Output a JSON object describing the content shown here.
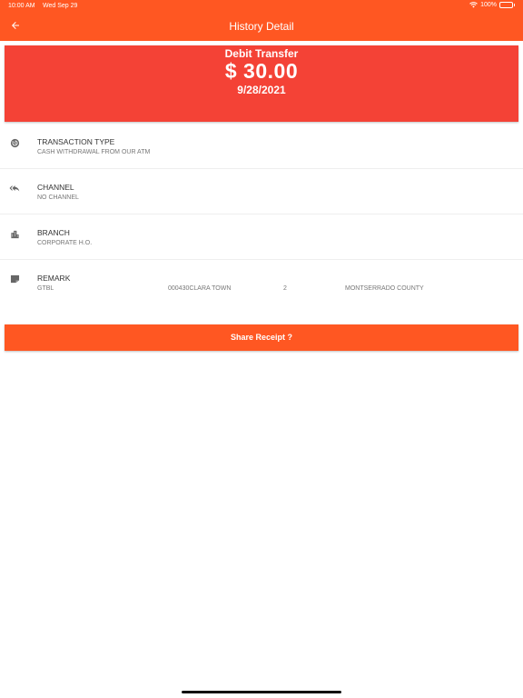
{
  "status_bar": {
    "time": "10:00 AM",
    "date": "Wed Sep 29",
    "battery": "100%"
  },
  "app_bar": {
    "title": "History Detail",
    "back_icon": "arrow-left-icon"
  },
  "summary": {
    "type": "Debit Transfer",
    "amount": "$ 30.00",
    "date": "9/28/2021"
  },
  "details": [
    {
      "icon": "history-icon",
      "label": "TRANSACTION TYPE",
      "value": "CASH WITHDRAWAL FROM OUR ATM"
    },
    {
      "icon": "reply-all-icon",
      "label": "CHANNEL",
      "value": "NO CHANNEL"
    },
    {
      "icon": "building-icon",
      "label": "BRANCH",
      "value": "CORPORATE H.O."
    },
    {
      "icon": "note-icon",
      "label": "REMARK",
      "values": [
        "GTBL",
        "000430CLARA TOWN",
        "2",
        "MONTSERRADO COUNTY"
      ]
    }
  ],
  "share_button": {
    "label": "Share Receipt ?"
  },
  "colors": {
    "header": "#ff5722",
    "card": "#f44236",
    "button": "#ff5722"
  }
}
